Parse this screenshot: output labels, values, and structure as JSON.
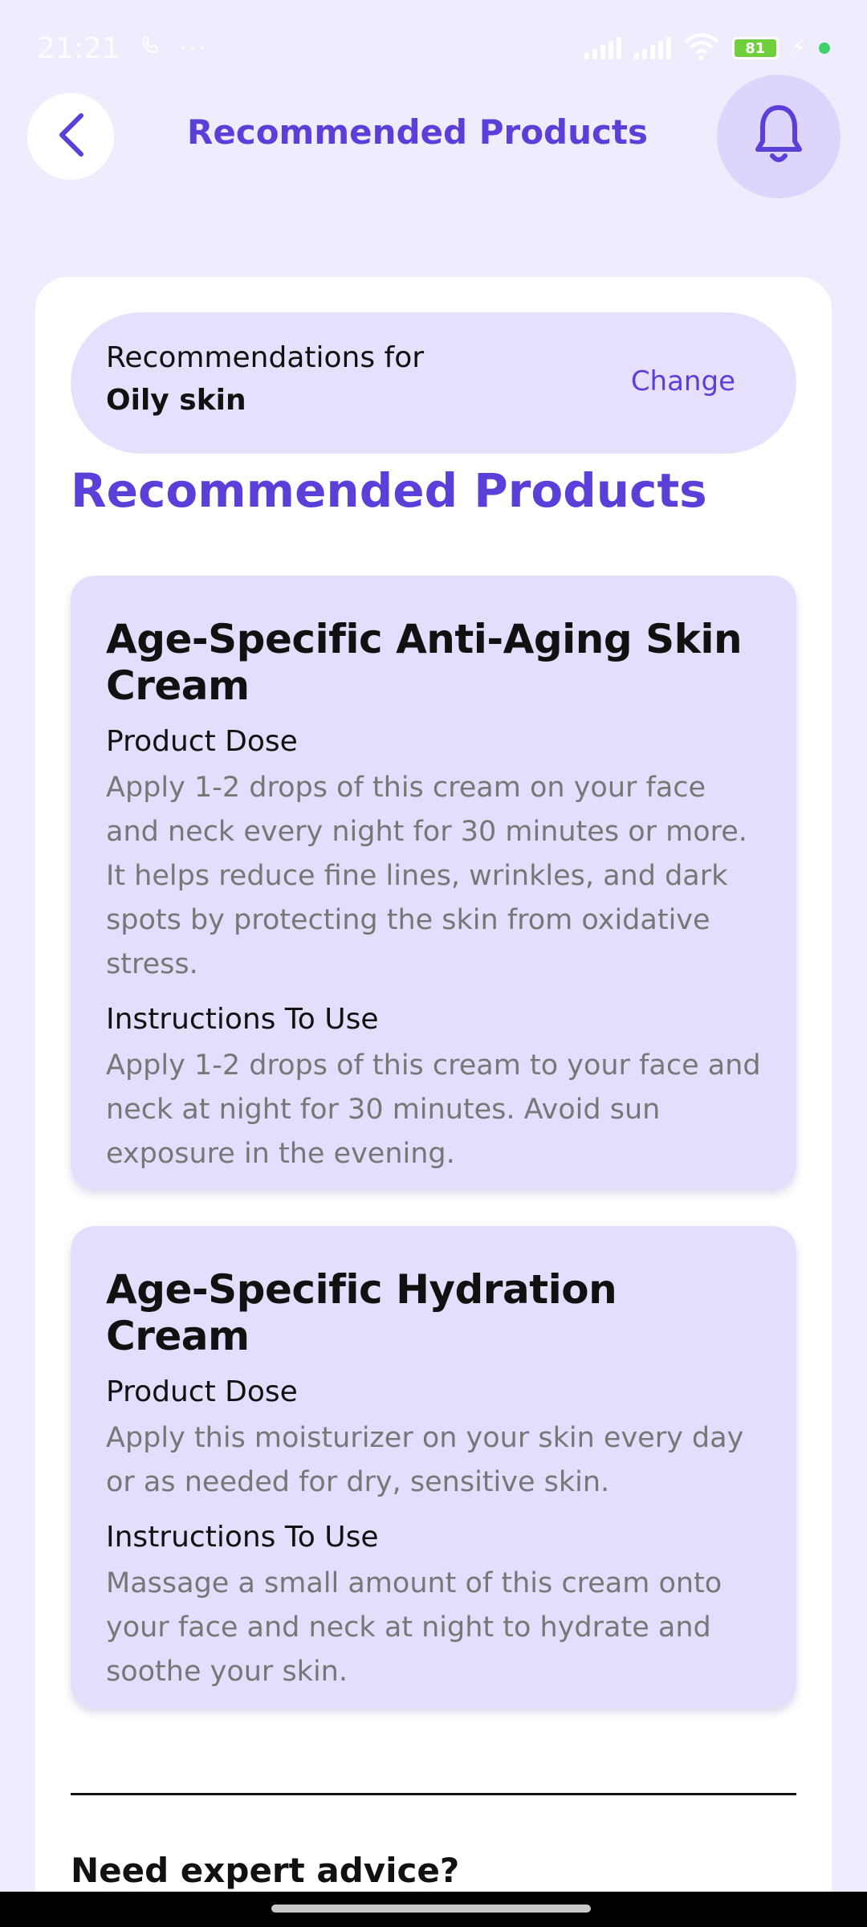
{
  "status_bar": {
    "time": "21:21",
    "battery": "81"
  },
  "header": {
    "title": "Recommended Products",
    "back_icon": "chevron-left-icon",
    "bell_icon": "bell-icon"
  },
  "recommendation": {
    "label": "Recommendations for",
    "value": "Oily skin",
    "change_label": "Change"
  },
  "section_title": "Recommended Products",
  "products": [
    {
      "name": "Age-Specific Anti-Aging Skin Cream",
      "dose_label": "Product Dose",
      "dose_text": "Apply 1-2 drops of this cream on your face and neck every night for 30 minutes or more. It helps reduce fine lines, wrinkles, and dark spots by protecting the skin from oxidative stress.",
      "instructions_label": "Instructions To Use",
      "instructions_text": "Apply 1-2 drops of this cream to your face and neck at night for 30 minutes. Avoid sun exposure in the evening."
    },
    {
      "name": "Age-Specific Hydration Cream",
      "dose_label": "Product Dose",
      "dose_text": "Apply this moisturizer on your skin every day or as needed for dry, sensitive skin.",
      "instructions_label": "Instructions To Use",
      "instructions_text": "Massage a small amount of this cream onto your face and neck at night to hydrate and soothe your skin."
    }
  ],
  "expert_prompt": "Need expert advice?",
  "colors": {
    "accent": "#5b3fd9",
    "card": "#e4defc",
    "background": "#efecfd"
  }
}
